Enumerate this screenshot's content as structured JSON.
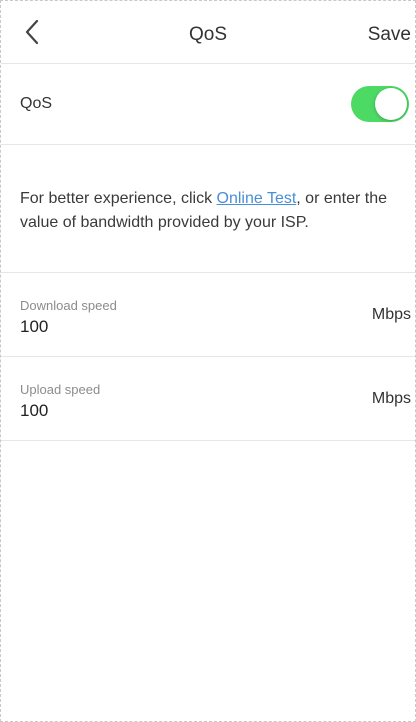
{
  "header": {
    "title": "QoS",
    "save_label": "Save"
  },
  "qos_toggle": {
    "label": "QoS",
    "enabled": true,
    "on_color": "#4cd964"
  },
  "info": {
    "text_before": "For better experience, click ",
    "link_text": "Online Test",
    "text_after": ", or enter the value of bandwidth provided by your ISP.",
    "link_color": "#4a8fd6"
  },
  "download": {
    "label": "Download speed",
    "value": "100",
    "unit": "Mbps"
  },
  "upload": {
    "label": "Upload speed",
    "value": "100",
    "unit": "Mbps"
  }
}
